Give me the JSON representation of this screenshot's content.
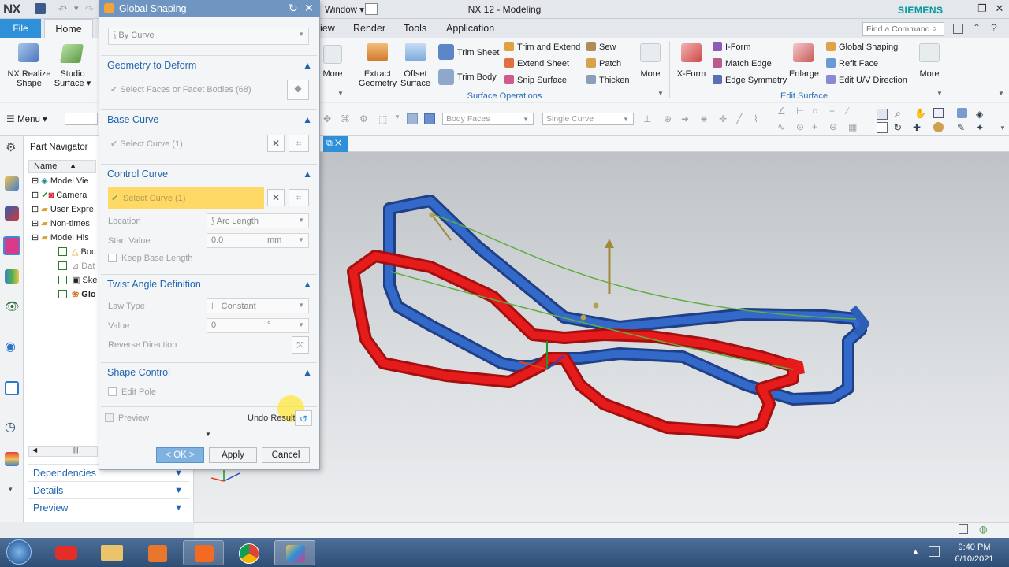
{
  "window": {
    "logo": "NX",
    "title": "NX 12 - Modeling",
    "brand": "SIEMENS",
    "window_menu": "Window ▾",
    "partial_tab": "iew"
  },
  "tabs": {
    "file": "File",
    "home": "Home",
    "render": "Render",
    "tools": "Tools",
    "application": "Application"
  },
  "search": {
    "placeholder": "Find a Command"
  },
  "ribbon": {
    "realize_shape": [
      "NX Realize",
      "Shape"
    ],
    "studio_surface": [
      "Studio",
      "Surface ▾"
    ],
    "more": "More",
    "extract_geometry": [
      "Extract",
      "Geometry"
    ],
    "offset_surface": [
      "Offset",
      "Surface"
    ],
    "trim_sheet": "Trim Sheet",
    "trim_body": "Trim Body",
    "trim_extend": "Trim and Extend",
    "extend_sheet": "Extend Sheet",
    "snip_surface": "Snip Surface",
    "sew": "Sew",
    "patch": "Patch",
    "thicken": "Thicken",
    "surface_ops_label": "Surface Operations",
    "xform": "X-Form",
    "iform": "I-Form",
    "match_edge": "Match Edge",
    "edge_symmetry": "Edge Symmetry",
    "enlarge": "Enlarge",
    "global_shaping": "Global Shaping",
    "refit_face": "Refit Face",
    "edit_uv": "Edit U/V Direction",
    "edit_surface_label": "Edit Surface"
  },
  "toolbar": {
    "menu": "Menu ▾",
    "body_faces": "Body Faces",
    "single_curve": "Single Curve"
  },
  "navigator": {
    "title": "Part Navigator",
    "col_name": "Name",
    "items": [
      "Model Views",
      "Cameras",
      "User Expressions",
      "Non-timestamp",
      "Model History",
      "Body",
      "Datum",
      "Sketch",
      "Global Shaping"
    ],
    "item_labels": [
      "Model Vie",
      "Camera",
      "User Expre",
      "Non-times",
      "Model His",
      "Boc",
      "Dat",
      "Ske",
      "Glo"
    ],
    "dependencies": "Dependencies",
    "details": "Details",
    "preview": "Preview"
  },
  "viewport": {
    "tab_label": "⧉ ✕"
  },
  "dialog": {
    "title": "Global Shaping",
    "type_value": "By Curve",
    "sections": {
      "geometry": "Geometry to Deform",
      "base_curve": "Base Curve",
      "control_curve": "Control Curve",
      "twist": "Twist Angle Definition",
      "shape_control": "Shape Control"
    },
    "select_faces": "Select Faces or Facet Bodies (68)",
    "select_curve_base": "Select Curve (1)",
    "select_curve_control": "Select Curve (1)",
    "location_label": "Location",
    "location_value": "Arc Length",
    "start_value_label": "Start Value",
    "start_value": "0.0",
    "start_unit": "mm",
    "keep_base_length": "Keep Base Length",
    "law_type_label": "Law Type",
    "law_type_value": "Constant",
    "value_label": "Value",
    "value_value": "0",
    "value_unit": "°",
    "reverse_direction": "Reverse Direction",
    "edit_pole": "Edit Pole",
    "preview": "Preview",
    "undo_result": "Undo Result",
    "ok": "< OK >",
    "apply": "Apply",
    "cancel": "Cancel"
  },
  "taskbar": {
    "time": "9:40 PM",
    "date": "6/10/2021"
  },
  "colors": {
    "accent_blue": "#2f8fd8",
    "dialog_header": "#6f95c0",
    "highlight_yellow": "#ffd966",
    "frame_red": "#e61b1b",
    "frame_blue": "#2d5fb8"
  }
}
